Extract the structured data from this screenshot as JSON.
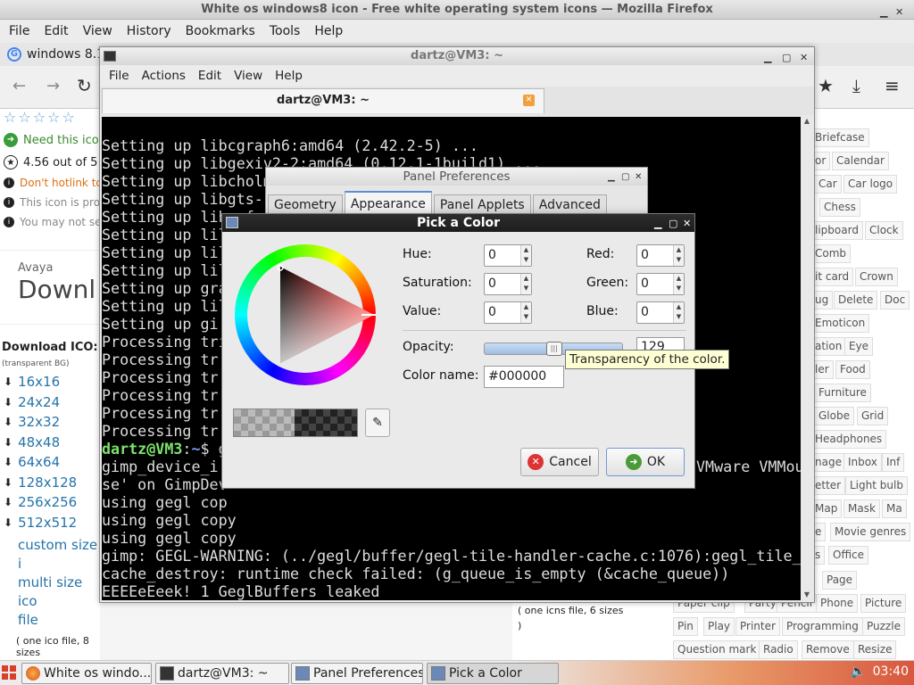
{
  "firefox": {
    "title": "White os windows8 icon - Free white operating system icons — Mozilla Firefox",
    "menu": [
      "File",
      "Edit",
      "View",
      "History",
      "Bookmarks",
      "Tools",
      "Help"
    ],
    "tab_label": "windows 8.1",
    "nav": {
      "back": "←",
      "forward": "→",
      "reload": "↻",
      "bookmarks": "★",
      "downloads": "⤓",
      "menu": "≡"
    }
  },
  "webpage": {
    "rating_stars": "☆☆☆☆☆",
    "need_this_icon": "Need this icon",
    "rating_text": "4.56 out of 5",
    "hotlink_warning": "Don't hotlink to",
    "icon_provided": "This icon is pro",
    "you_may_not": "You may not se",
    "ad_brand": "Avaya",
    "ad_title": "Downl",
    "download_ico_heading": "Download ICO:",
    "download_ico_sub": "(transparent BG)",
    "sizes": [
      "16x16",
      "24x24",
      "32x32",
      "48x48",
      "64x64",
      "128x128",
      "256x256",
      "512x512"
    ],
    "custom_size": "custom size i",
    "multi_size": "multi size ico",
    "file_label": "file",
    "ico_note": "( one ico file, 8 sizes",
    "ico_note_end": ")",
    "icns_note": "( one icns file, 6 sizes",
    "icns_note_end": ")",
    "tags": [
      "Briefcase",
      "or",
      "Calendar",
      "Car",
      "Car logo",
      "Chess",
      "lipboard",
      "Clock",
      "Comb",
      "it card",
      "Crown",
      "ug",
      "Delete",
      "Doc",
      "Emoticon",
      "ation",
      "Eye",
      "ler",
      "Food",
      "Furniture",
      "Globe",
      "Grid",
      "Headphones",
      "nage",
      "Inbox",
      "Inf",
      "etter",
      "Light bulb",
      "Map",
      "Mask",
      "Ma",
      "e",
      "Movie genres",
      "s",
      "Office",
      "Page",
      "Paper clip",
      "Party",
      "Pencil",
      "Phone",
      "Picture",
      "Pin",
      "Play",
      "Printer",
      "Programming",
      "Puzzle",
      "Question mark",
      "Radio",
      "Remove",
      "Resize"
    ]
  },
  "terminal": {
    "title": "dartz@VM3: ~",
    "menu": [
      "File",
      "Actions",
      "Edit",
      "View",
      "Help"
    ],
    "tab_label": "dartz@VM3: ~",
    "tab_close": "✕",
    "prompt_user": "dartz@VM3",
    "prompt_sep": ":",
    "prompt_path": "~",
    "prompt_dollar": "$",
    "lines": [
      "Setting up libcgraph6:amd64 (2.42.2-5) ...",
      "Setting up libgexiv2-2:amd64 (0.12.1-1build1) ...",
      "Setting up libcholmod3:amd64 (1:5.8.1+dfsg-2) ...",
      "Setting up libgts-",
      "Setting up libumfp",
      "Setting up lil",
      "Setting up lil",
      "Setting up lil",
      "Setting up gra",
      "Setting up lil",
      "Setting up gi",
      "Processing tri",
      "Processing tr",
      "Processing tr",
      "Processing tr",
      "Processing tr",
      "Processing tr"
    ],
    "cmd_line_rest": "g",
    "line_gimp_device": "gimp_device_i",
    "line_vmware": "VMware VMMou",
    "line_se": "se' on GimpDev",
    "line_gegl1": "using gegl cop",
    "line_gegl2": "using gegl copy",
    "line_gegl3": "using gegl copy",
    "line_warn1": "gimp: GEGL-WARNING: (../gegl/buffer/gegl-tile-handler-cache.c:1076):gegl_tile_",
    "line_warn2": "cache_destroy: runtime check failed: (g_queue_is_empty (&cache_queue))",
    "line_warn3": "EEEEeEeek! 1 GeglBuffers leaked"
  },
  "panel_prefs": {
    "title": "Panel Preferences",
    "tabs": [
      "Geometry",
      "Appearance",
      "Panel Applets",
      "Advanced"
    ],
    "active_tab": 1
  },
  "color_picker": {
    "title": "Pick a Color",
    "labels": {
      "hue": "Hue:",
      "saturation": "Saturation:",
      "value": "Value:",
      "red": "Red:",
      "green": "Green:",
      "blue": "Blue:",
      "opacity": "Opacity:",
      "color_name": "Color name:"
    },
    "values": {
      "hue": "0",
      "saturation": "0",
      "value": "0",
      "red": "0",
      "green": "0",
      "blue": "0",
      "opacity": "129"
    },
    "opacity_fraction": 0.506,
    "color_name": "#000000",
    "tooltip": "Transparency of the color.",
    "cancel": "Cancel",
    "ok": "OK"
  },
  "taskbar": {
    "tasks": [
      "White os windo...",
      "dartz@VM3: ~",
      "Panel Preferences",
      "Pick a Color"
    ],
    "clock": "03:40"
  },
  "colors": {
    "terminal_bg": "#000000",
    "prompt_user": "#7ce36b",
    "prompt_path": "#6e9cf0",
    "link": "#2574a9",
    "tooltip_bg": "#ffffd4"
  }
}
